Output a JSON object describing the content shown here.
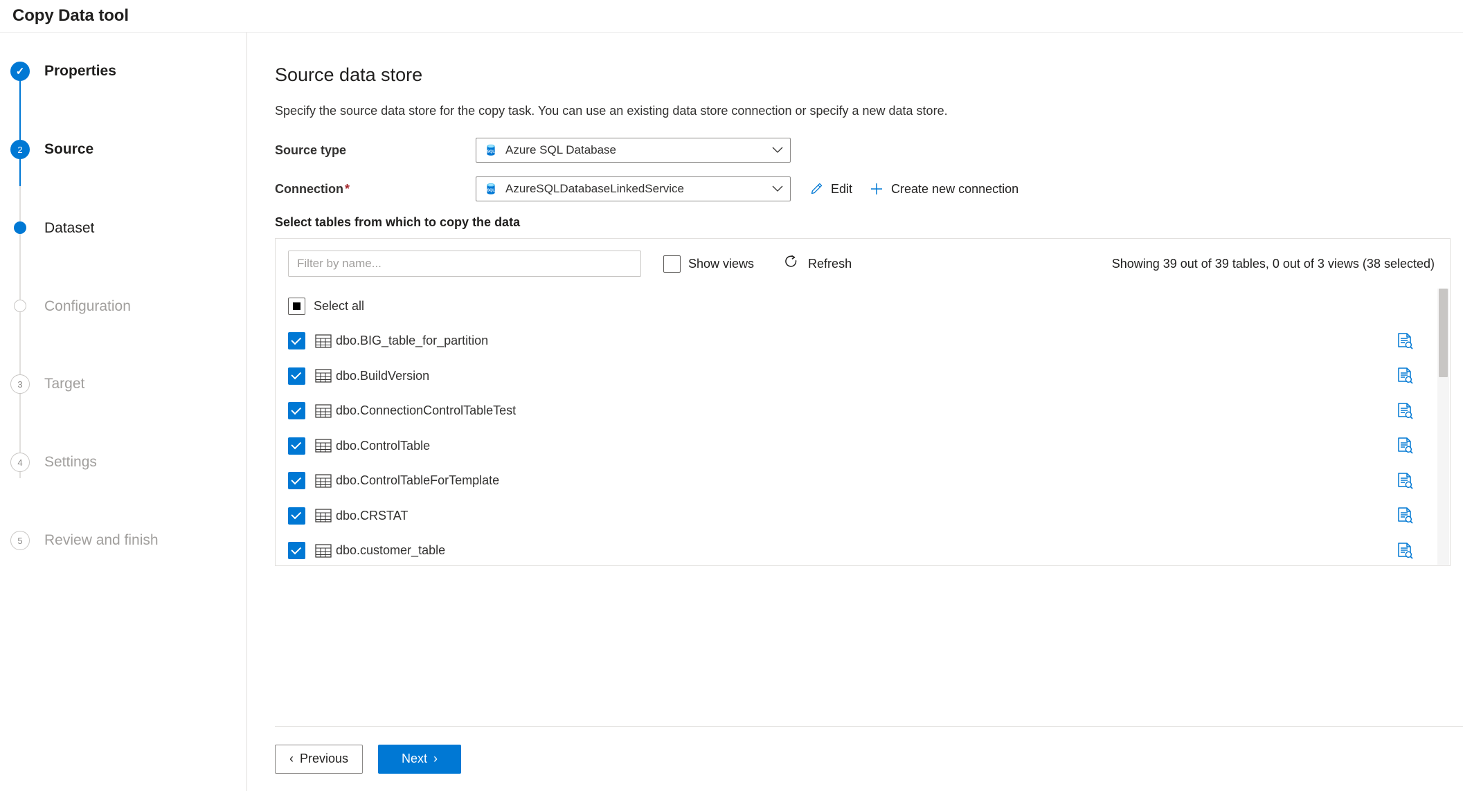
{
  "window": {
    "title": "Copy Data tool"
  },
  "wizard": {
    "steps": [
      {
        "label": "Properties",
        "marker": "check",
        "state": "done"
      },
      {
        "label": "Source",
        "marker": "2",
        "state": "active"
      },
      {
        "label": "Dataset",
        "marker": "dot",
        "state": "current-sub"
      },
      {
        "label": "Configuration",
        "marker": "circle",
        "state": "pending-sub"
      },
      {
        "label": "Target",
        "marker": "3",
        "state": "pending"
      },
      {
        "label": "Settings",
        "marker": "4",
        "state": "pending"
      },
      {
        "label": "Review and finish",
        "marker": "5",
        "state": "pending"
      }
    ]
  },
  "page": {
    "title": "Source data store",
    "description": "Specify the source data store for the copy task. You can use an existing data store connection or specify a new data store."
  },
  "form": {
    "source_type": {
      "label": "Source type",
      "value": "Azure SQL Database",
      "icon": "azure-sql-database-icon",
      "chevron": "⌄"
    },
    "connection": {
      "label": "Connection",
      "required_marker": "*",
      "value": "AzureSQLDatabaseLinkedService",
      "icon": "azure-sql-database-icon",
      "chevron": "⌄",
      "edit_label": "Edit",
      "create_label": "Create new connection"
    }
  },
  "picker": {
    "heading": "Select tables from which to copy the data",
    "filter_placeholder": "Filter by name...",
    "filter_value": "",
    "show_views_label": "Show views",
    "show_views_checked": false,
    "refresh_label": "Refresh",
    "status_text": "Showing 39 out of 39 tables, 0 out of 3 views (38 selected)",
    "select_all_label": "Select all",
    "select_all_state": "indeterminate",
    "rows": [
      {
        "name": "dbo.BIG_table_for_partition",
        "checked": true
      },
      {
        "name": "dbo.BuildVersion",
        "checked": true
      },
      {
        "name": "dbo.ConnectionControlTableTest",
        "checked": true
      },
      {
        "name": "dbo.ControlTable",
        "checked": true
      },
      {
        "name": "dbo.ControlTableForTemplate",
        "checked": true
      },
      {
        "name": "dbo.CRSTAT",
        "checked": true
      },
      {
        "name": "dbo.customer_table",
        "checked": true
      }
    ]
  },
  "footer": {
    "previous_label": "Previous",
    "previous_chevron": "‹",
    "next_label": "Next",
    "next_chevron": "›"
  },
  "colors": {
    "accent": "#0078d4",
    "required": "#a4262c",
    "muted_text": "#a19f9d",
    "border": "#e1dfdd"
  }
}
